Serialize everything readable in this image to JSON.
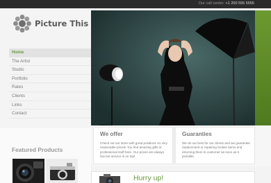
{
  "header": {
    "callcenter_label": "Our call center:",
    "callcenter_number": "+1 200 555 5555"
  },
  "logo": {
    "text": "Picture This"
  },
  "nav": {
    "items": [
      {
        "label": "Home",
        "active": true
      },
      {
        "label": "The Artist"
      },
      {
        "label": "Studio"
      },
      {
        "label": "Portfolio"
      },
      {
        "label": "Rates"
      },
      {
        "label": "Clients"
      },
      {
        "label": "Links"
      },
      {
        "label": "Contact"
      }
    ]
  },
  "featured": {
    "title": "Featured Products"
  },
  "offer": {
    "title": "We offer",
    "text": "Check out our store with great positions on very reasonable prices! You find amazing gifts or professional stuff here. Our prices are always low but service is on top!"
  },
  "guarantees": {
    "title": "Guaranties",
    "text": "We do our best for our clients and we guarantee replacement or repairing broken items and returning them to customer as soon as it possible."
  },
  "promo": {
    "title": "Hurry up!"
  },
  "colors": {
    "accent": "#6a9a3e",
    "topbar": "#2b2b2b",
    "hero_bg": "#2f4a4a"
  }
}
